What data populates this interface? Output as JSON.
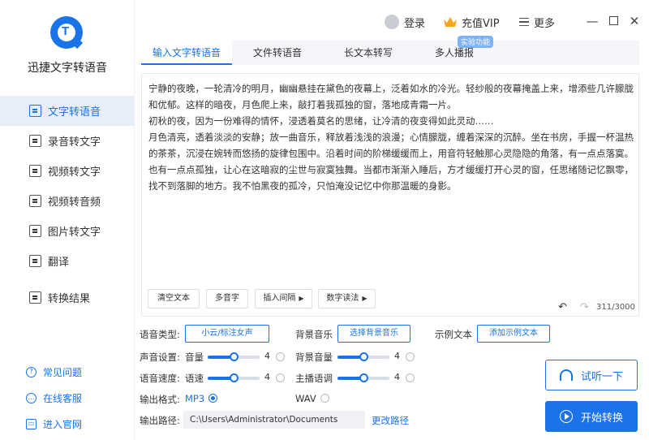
{
  "app": {
    "name": "迅捷文字转语音"
  },
  "sidebar": {
    "items": [
      {
        "label": "文字转语音",
        "icon": "text-to-speech-icon",
        "active": true
      },
      {
        "label": "录音转文字",
        "icon": "recording-to-text-icon"
      },
      {
        "label": "视频转文字",
        "icon": "video-to-text-icon"
      },
      {
        "label": "视频转音频",
        "icon": "video-to-audio-icon"
      },
      {
        "label": "图片转文字",
        "icon": "image-to-text-icon"
      },
      {
        "label": "翻译",
        "icon": "translate-icon"
      }
    ],
    "results": {
      "label": "转换结果",
      "icon": "results-icon"
    },
    "bottom": [
      {
        "label": "常见问题",
        "icon": "help-icon"
      },
      {
        "label": "在线客服",
        "icon": "support-icon"
      },
      {
        "label": "进入官网",
        "icon": "website-icon"
      }
    ]
  },
  "topbar": {
    "login": "登录",
    "vip": "充值VIP",
    "more": "更多"
  },
  "tabs": [
    {
      "label": "输入文字转语音",
      "active": true
    },
    {
      "label": "文件转语音"
    },
    {
      "label": "长文本转写"
    },
    {
      "label": "多人播报"
    }
  ],
  "lab_badge": "实验功能",
  "editor": {
    "text": "宁静的夜晚，一轮清冷的明月，幽幽悬挂在黛色的夜幕上，泛着如水的冷光。轻纱般的夜幕掩盖上来，增添些几许朦胧和优郁。这样的暗夜，月色爬上来，敲打着我孤独的窗，落地成青霜一片。\n初秋的夜，因为一份难得的情怀，浸透着莫名的思绪，让冷清的夜变得如此灵动……\n月色清亮，透着淡淡的安静；放一曲音乐，释放着浅浅的浪漫；心情朦胧，缠着深深的沉醉。坐在书房，手握一杯温热的茶茶，沉浸在婉转而悠扬的旋律包围中。沿着时间的阶梯缓缓而上，用音符轻触那心灵隐隐的角落，有一点点落寞。也有一点点孤独，让心在这暗寂的尘世与寂寞独舞。当都市渐渐入睡后，方才缓缓打开心灵的窗，任思绪随记忆飘零，找不到落脚的地方。我不怕黑夜的孤冷，只怕淹没记忆中你那温暖的身影。",
    "buttons": {
      "clear": "清空文本",
      "polyphone": "多音字",
      "pause": "插入间隔",
      "digits": "数字读法"
    },
    "count": "311/3000"
  },
  "settings": {
    "voice_type_label": "语音类型:",
    "voice_type_value": "小云/标注女声",
    "bg_music_label": "背景音乐",
    "bg_music_button": "选择背景音乐",
    "sample_label": "示例文本",
    "sample_button": "添加示例文本",
    "sound_label": "声音设置:",
    "volume_label": "音量",
    "volume_value": "4",
    "bg_volume_label": "背景音量",
    "bg_volume_value": "4",
    "speed_label": "语音速度:",
    "speed_sub_label": "语速",
    "speed_value": "4",
    "pitch_label": "主播语调",
    "pitch_value": "4",
    "format_label": "输出格式:",
    "format_mp3": "MP3",
    "format_wav": "WAV",
    "path_label": "输出路径:",
    "path_value": "C:\\Users\\Administrator\\Documents",
    "change_path": "更改路径"
  },
  "actions": {
    "listen": "试听一下",
    "start": "开始转换"
  },
  "colors": {
    "accent": "#1a73e8",
    "active_bg": "#e8eef9"
  },
  "sliders": {
    "volume_fraction": 0.5,
    "bg_volume_fraction": 0.5,
    "speed_fraction": 0.5,
    "pitch_fraction": 0.5
  }
}
